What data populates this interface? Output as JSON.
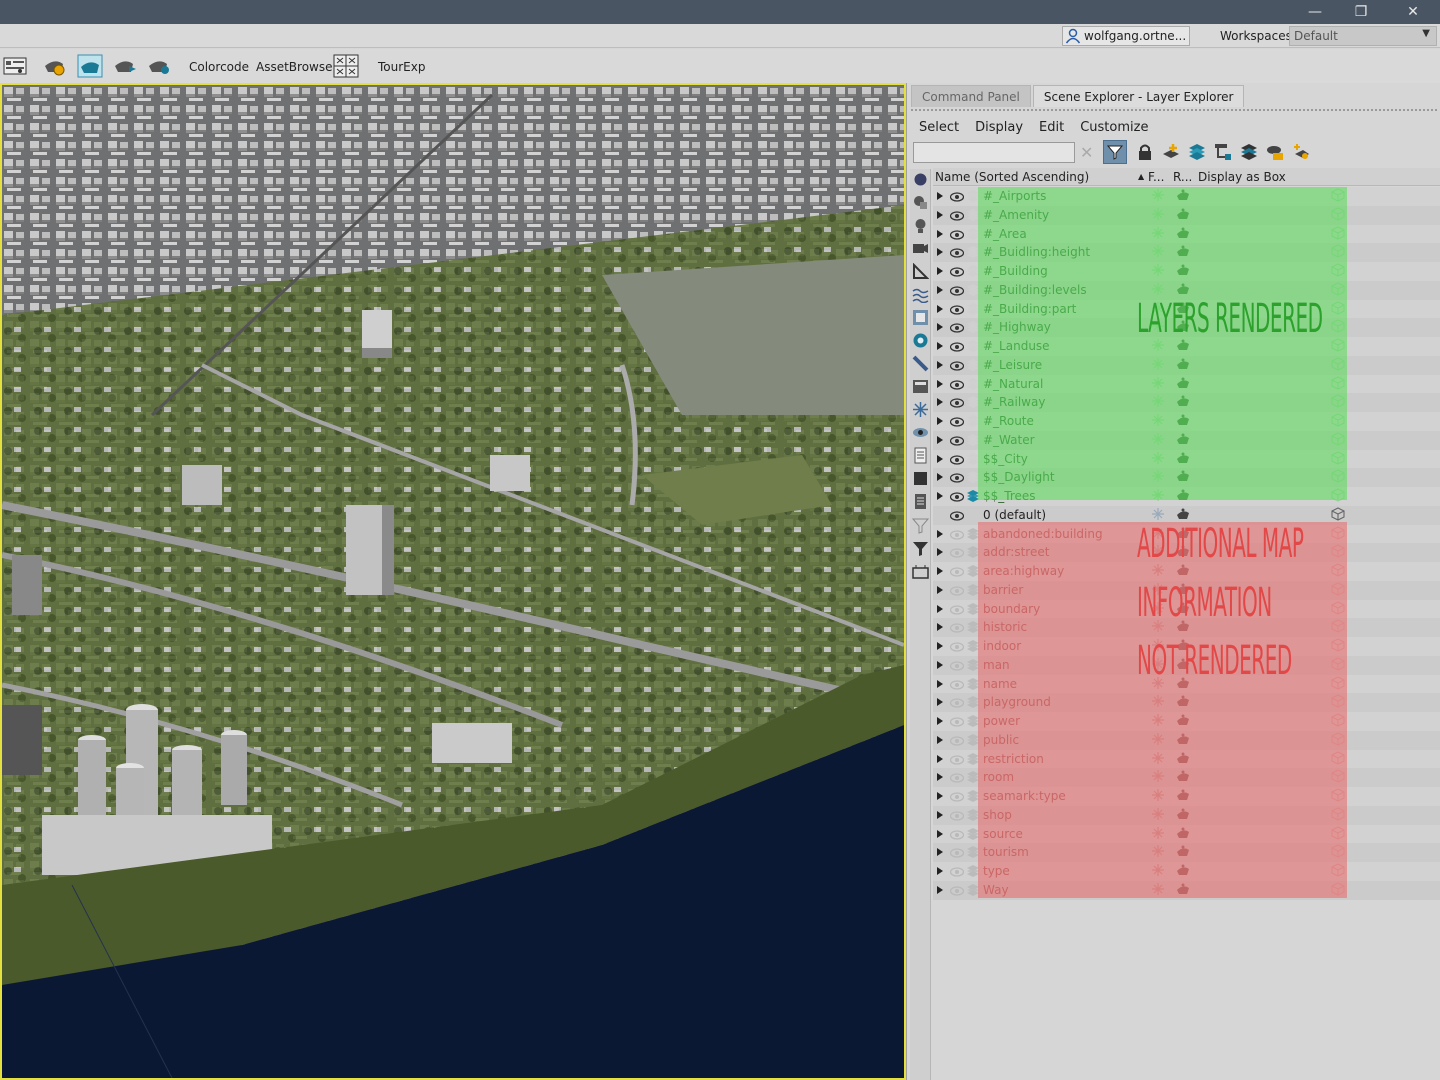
{
  "window": {
    "controls": [
      "minimize",
      "restore",
      "close"
    ]
  },
  "userbar": {
    "user": "wolfgang.ortne...",
    "workspaces_label": "Workspaces:",
    "workspace_value": "Default"
  },
  "toolbar": {
    "colorcode": "Colorcode",
    "assetbrowser": "AssetBrowser",
    "tourexp": "TourExp"
  },
  "panel": {
    "tabs": [
      "Command Panel",
      "Scene Explorer - Layer Explorer"
    ],
    "menus": [
      "Select",
      "Display",
      "Edit",
      "Customize"
    ],
    "search_value": "",
    "columns": {
      "name": "Name (Sorted Ascending)",
      "frozen": "F...",
      "render": "R...",
      "display_box": "Display as Box"
    },
    "rendered_layers": [
      "#_Airports",
      "#_Amenity",
      "#_Area",
      "#_Buidling:height",
      "#_Building",
      "#_Building:levels",
      "#_Building:part",
      "#_Highway",
      "#_Landuse",
      "#_Leisure",
      "#_Natural",
      "#_Railway",
      "#_Route",
      "#_Water",
      "$$_City",
      "$$_Daylight",
      "$$_Trees"
    ],
    "default_layer": "0 (default)",
    "not_rendered_layers": [
      "abandoned:building",
      "addr:street",
      "area:highway",
      "barrier",
      "boundary",
      "historic",
      "indoor",
      "man",
      "name",
      "playground",
      "power",
      "public",
      "restriction",
      "room",
      "seamark:type",
      "shop",
      "source",
      "tourism",
      "type",
      "Way"
    ]
  },
  "annotations": {
    "rendered": "LAYERS RENDERED",
    "not_rendered": [
      "ADDITIONAL MAP",
      "INFORMATION",
      "NOT RENDERED"
    ]
  },
  "colors": {
    "highlight_green": "#5fdc5f",
    "highlight_red": "#e66e6e",
    "annotation_green": "#2ca12c",
    "annotation_red": "#e34848",
    "viewport_border": "#e4e040",
    "water": "#0b1833"
  }
}
